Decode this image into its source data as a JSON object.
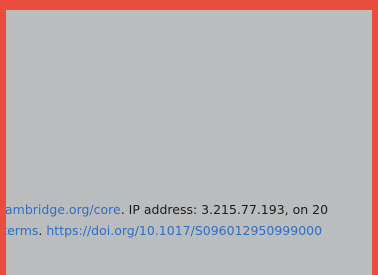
{
  "footer": {
    "line1": {
      "link": "ambridge.org/core",
      "text": ". IP address: 3.215.77.193, on 20"
    },
    "line2": {
      "link": "/terms",
      "separator": ". ",
      "doi": "https://doi.org/10.1017/S096012950999000"
    }
  },
  "colors": {
    "border": "#ea4d3e",
    "page": "#bbbcbe",
    "link": "#2d6fc4",
    "text": "#1c1c1c"
  }
}
